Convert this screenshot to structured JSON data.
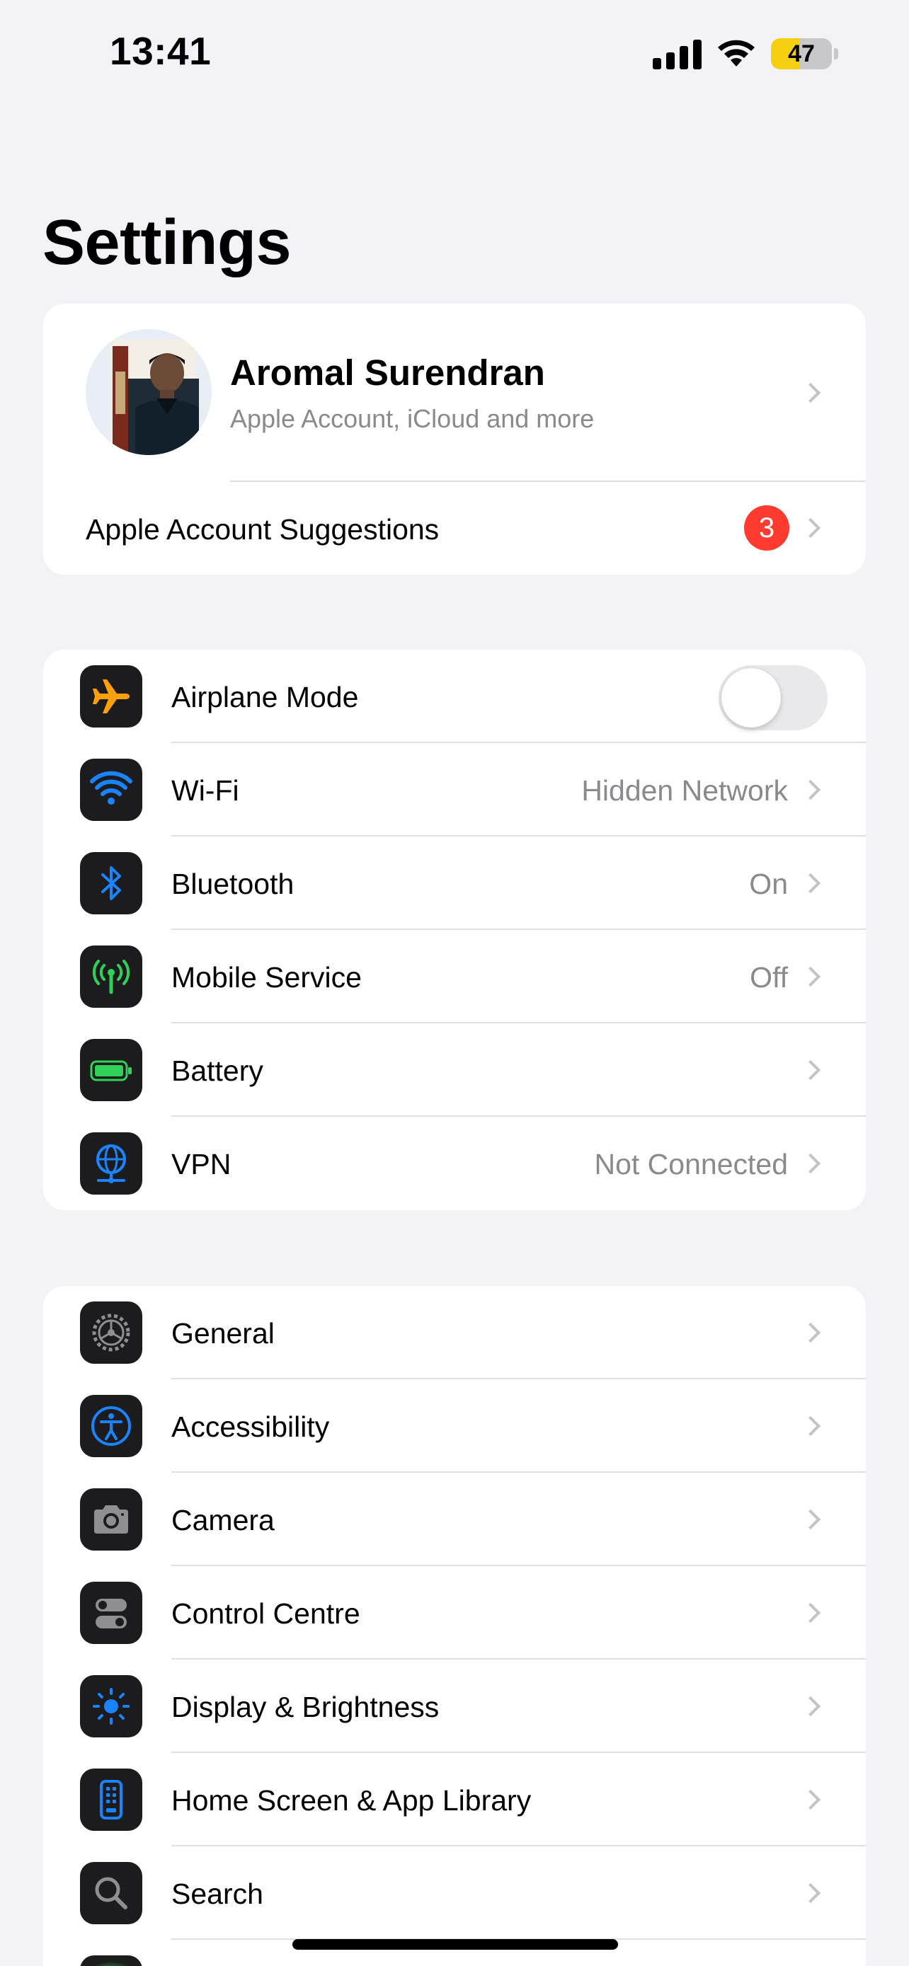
{
  "status_bar": {
    "time": "13:41",
    "battery_level": "47"
  },
  "title": "Settings",
  "profile": {
    "name": "Aromal Surendran",
    "subtitle": "Apple Account, iCloud and more",
    "suggestions_label": "Apple Account Suggestions",
    "suggestions_count": "3"
  },
  "connectivity": [
    {
      "label": "Airplane Mode",
      "value": "",
      "icon": "airplane-icon",
      "toggle_on": false
    },
    {
      "label": "Wi-Fi",
      "value": "Hidden Network",
      "icon": "wifi-icon"
    },
    {
      "label": "Bluetooth",
      "value": "On",
      "icon": "bluetooth-icon"
    },
    {
      "label": "Mobile Service",
      "value": "Off",
      "icon": "antenna-icon"
    },
    {
      "label": "Battery",
      "value": "",
      "icon": "battery-icon"
    },
    {
      "label": "VPN",
      "value": "Not Connected",
      "icon": "globe-icon"
    }
  ],
  "general": [
    {
      "label": "General",
      "icon": "gear-icon"
    },
    {
      "label": "Accessibility",
      "icon": "accessibility-icon"
    },
    {
      "label": "Camera",
      "icon": "camera-icon"
    },
    {
      "label": "Control Centre",
      "icon": "switches-icon"
    },
    {
      "label": "Display & Brightness",
      "icon": "sun-icon"
    },
    {
      "label": "Home Screen & App Library",
      "icon": "phone-grid-icon"
    },
    {
      "label": "Search",
      "icon": "magnifier-icon"
    }
  ],
  "colors": {
    "background": "#f2f2f7",
    "accent_blue": "#1a84ff",
    "airplane_orange": "#ff9f0a",
    "mobile_green": "#30d158",
    "badge_red": "#ff3b30",
    "battery_yellow": "#f6cf11"
  }
}
